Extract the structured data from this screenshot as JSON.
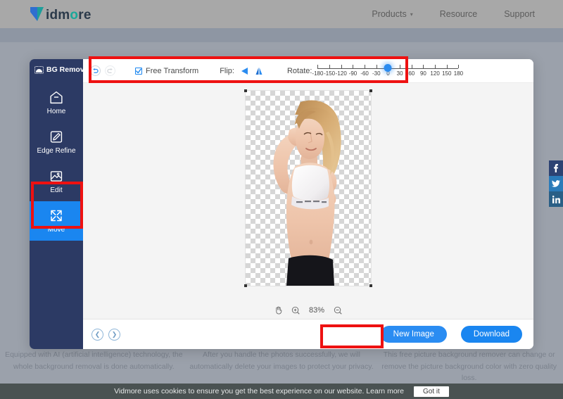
{
  "site": {
    "logo": {
      "prefix": "id",
      "accent": "o",
      "suffix": "m",
      "tail": "re",
      "full": "idmore"
    },
    "nav": [
      {
        "label": "Products",
        "has_dropdown": true,
        "icon": "chevron-down-icon"
      },
      {
        "label": "Resource",
        "has_dropdown": false
      },
      {
        "label": "Support",
        "has_dropdown": false
      }
    ]
  },
  "social_rail": [
    {
      "name": "facebook-icon",
      "glyph": "f",
      "color": "#2d4373"
    },
    {
      "name": "twitter-icon",
      "glyph": "✉",
      "color": "#2b7bb9"
    },
    {
      "name": "linkedin-icon",
      "glyph": "in",
      "color": "#2a5f86"
    }
  ],
  "app": {
    "sidebar": {
      "title": "BG Remover",
      "title_icon": "image-mask-icon",
      "items": [
        {
          "label": "Home",
          "icon": "home-icon",
          "active": false
        },
        {
          "label": "Edge Refine",
          "icon": "edge-refine-pen-icon",
          "active": false
        },
        {
          "label": "Edit",
          "icon": "edit-image-icon",
          "active": false
        },
        {
          "label": "Move",
          "icon": "move-arrows-icon",
          "active": true
        }
      ]
    },
    "toolbar": {
      "undo_icon": "undo-icon",
      "redo_icon": "redo-icon",
      "undo_enabled": true,
      "redo_enabled": false,
      "free_transform_label": "Free Transform",
      "free_transform_checked": true,
      "flip_label": "Flip:",
      "flip_horizontal_icon": "flip-horizontal-icon",
      "flip_vertical_icon": "flip-vertical-icon",
      "rotate_label": "Rotate:",
      "rotate_value": 0,
      "rotate_min": -180,
      "rotate_max": 180,
      "rotate_ticks": [
        -180,
        -150,
        -120,
        -90,
        -60,
        -30,
        0,
        30,
        60,
        90,
        120,
        150,
        180
      ]
    },
    "canvas": {
      "background": "transparent-checkerboard",
      "subject_alt": "woman-with-background-removed",
      "selection_handles": 4
    },
    "zoom_bar": {
      "hand_icon": "hand-tool-icon",
      "zoom_in_icon": "zoom-in-icon",
      "zoom_level": "83%",
      "zoom_out_icon": "zoom-out-icon"
    },
    "footer": {
      "prev_icon": "chevron-left-icon",
      "next_icon": "chevron-right-icon",
      "new_image_label": "New Image",
      "download_label": "Download"
    }
  },
  "features": [
    "Equipped with AI (artificial intelligence) technology, the whole background removal is done automatically.",
    "After you handle the photos successfully, we will automatically delete your images to protect your privacy.",
    "This free picture background remover can change or remove the picture background color with zero quality loss."
  ],
  "cookie": {
    "text": "Vidmore uses cookies to ensure you get the best experience on our website.",
    "learn_more": "Learn more",
    "button": "Got it"
  },
  "annotations": {
    "accent_red": "#ee1111",
    "boxes": [
      {
        "name": "toolbar-highlight"
      },
      {
        "name": "move-tool-highlight"
      },
      {
        "name": "download-button-highlight"
      }
    ]
  },
  "colors": {
    "brand_blue": "#1a86f0",
    "sidebar_navy": "#2c3a64",
    "logo_teal": "#1aa89a"
  }
}
